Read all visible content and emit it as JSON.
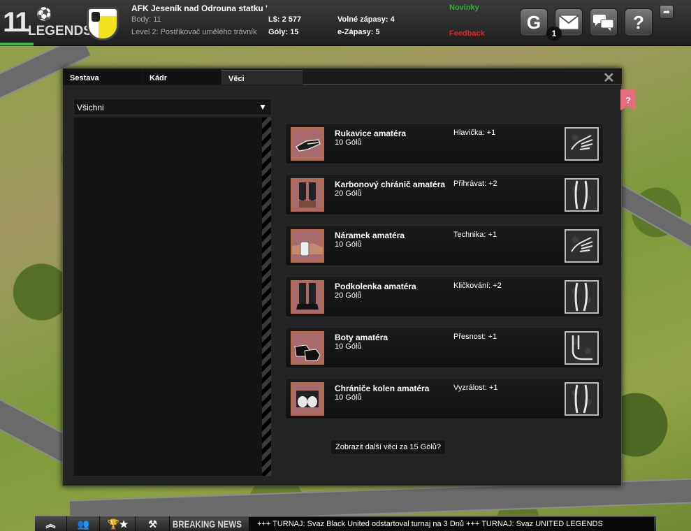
{
  "header": {
    "logo_number": "11",
    "logo_word": "LEGENDS",
    "club_name": "AFK Jeseník nad Odrouna statku '",
    "body_label": "Body:",
    "body_value": "11",
    "level_text": "Level 2: Postřikovač umělého trávník",
    "ls_label": "L$:",
    "ls_value": "2 577",
    "goals_label": "Góly:",
    "goals_value": "15",
    "reserves_label": "Volné zápasy:",
    "reserves_value": "4",
    "ereserves_label": "e-Zápasy:",
    "ereserves_value": "5",
    "news_link": "Novinky",
    "feedback_link": "Feedback",
    "g_button": "G",
    "mail_badge": "1"
  },
  "modal": {
    "tabs": [
      "Sestava",
      "Kádr",
      "Věci"
    ],
    "active_tab": "Věci",
    "filter_value": "Všichni",
    "items": [
      {
        "name": "Rukavice amatéra",
        "price": "10 Gólů",
        "bonus": "Hlavička: +1",
        "slot": "hand"
      },
      {
        "name": "Karbonový chránič amatéra",
        "price": "20 Gólů",
        "bonus": "Přihrávat: +2",
        "slot": "leg"
      },
      {
        "name": "Náramek amatéra",
        "price": "10 Gólů",
        "bonus": "Technika: +1",
        "slot": "hand"
      },
      {
        "name": "Podkolenka amatéra",
        "price": "20 Gólů",
        "bonus": "Kličkování: +2",
        "slot": "leg"
      },
      {
        "name": "Boty amatéra",
        "price": "10 Gólů",
        "bonus": "Přesnost: +1",
        "slot": "foot"
      },
      {
        "name": "Chrániče kolen amatéra",
        "price": "10 Gólů",
        "bonus": "Vyzrálost: +1",
        "slot": "leg"
      }
    ],
    "more_button": "Zobrazit další věci za 15 Gólů?",
    "help_flag": "?"
  },
  "ticker": {
    "breaking_label": "BREAKING NEWS",
    "text": "+++   TURNAJ: Svaz Black United odstartoval turnaj na 3 Dnů   +++   TURNAJ: Svaz UNITED LEGENDS"
  }
}
